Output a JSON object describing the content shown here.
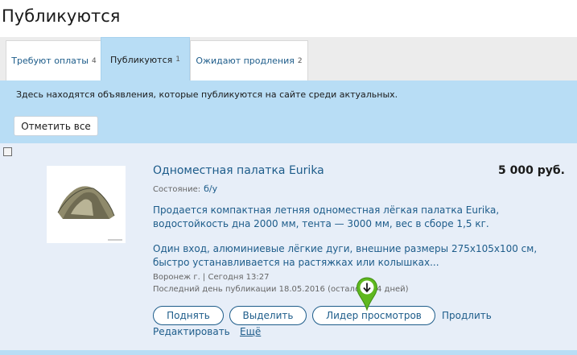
{
  "page": {
    "title": "Публикуются"
  },
  "tabs": [
    {
      "label": "Требуют оплаты",
      "count": "4"
    },
    {
      "label": "Публикуются",
      "count": "1"
    },
    {
      "label": "Ожидают продления",
      "count": "2"
    }
  ],
  "info": {
    "text": "Здесь находятся объявления, которые публикуются на сайте среди актуальных.",
    "mark_all_label": "Отметить все"
  },
  "listing": {
    "title": "Одноместная палатка Eurika",
    "price": "5 000 руб.",
    "condition_label": "Состояние:",
    "condition_value": "б/у",
    "description_1": "Продается компактная летняя одноместная лёгкая палатка Eurika, водостойкость дна 2000 мм, тента — 3000 мм, вес в сборе 1,5 кг.",
    "description_2": "Один вход, алюминиевые лёгкие дуги, внешние размеры 275х105х100 см, быстро устанавливается на растяжках или колышках...",
    "location_time": "Воронеж г.  |  Сегодня 13:27",
    "last_day": "Последний день публикации 18.05.2016 (осталось 14 дней)",
    "image_icon": "tent-photo"
  },
  "actions": {
    "raise": "Поднять",
    "highlight": "Выделить",
    "leader": "Лидер просмотров",
    "extend": "Продлить",
    "edit": "Редактировать",
    "more": "Ещё"
  },
  "colors": {
    "accent_blue": "#1d5c8a",
    "band": "#b8ddf5",
    "list_bg": "#e7eef8",
    "pin_green": "#5fb81f"
  }
}
